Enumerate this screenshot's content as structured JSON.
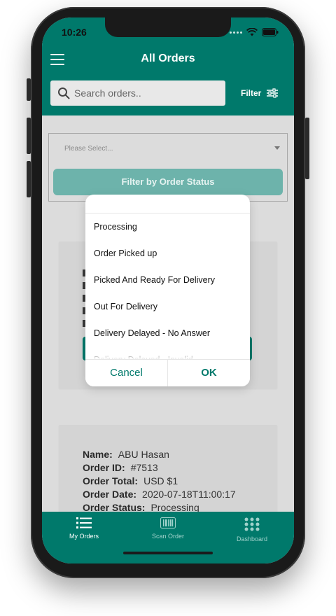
{
  "status_bar": {
    "time": "10:26"
  },
  "header": {
    "title": "All Orders",
    "search_placeholder": "Search orders..",
    "filter_label": "Filter"
  },
  "filter_panel": {
    "select_placeholder": "Please Select...",
    "button_label": "Filter by Order Status"
  },
  "status_picker": {
    "options": [
      "Processing",
      "Order Picked up",
      "Picked And Ready For Delivery",
      "Out For Delivery",
      "Delivery Delayed - No Answer",
      "Delivery Delayed - Invalid..."
    ],
    "cancel_label": "Cancel",
    "ok_label": "OK"
  },
  "orders": [
    {
      "name_label": "Name:",
      "name": "ABU Hasan",
      "id_label": "Order ID:",
      "id": "#7513",
      "total_label": "Order Total:",
      "total": "USD $1",
      "date_label": "Order Date:",
      "date": "2020-07-18T11:00:17",
      "status_label": "Order Status:",
      "status": "Processing"
    }
  ],
  "bottom_nav": {
    "items": [
      {
        "label": "My Orders",
        "icon": "list-icon",
        "active": true
      },
      {
        "label": "Scan Order",
        "icon": "barcode-icon",
        "active": false
      },
      {
        "label": "Dashboard",
        "icon": "grid-icon",
        "active": false
      }
    ]
  },
  "colors": {
    "primary": "#00796b",
    "background": "#dcdcdc",
    "button_disabled": "#6db3ab"
  }
}
